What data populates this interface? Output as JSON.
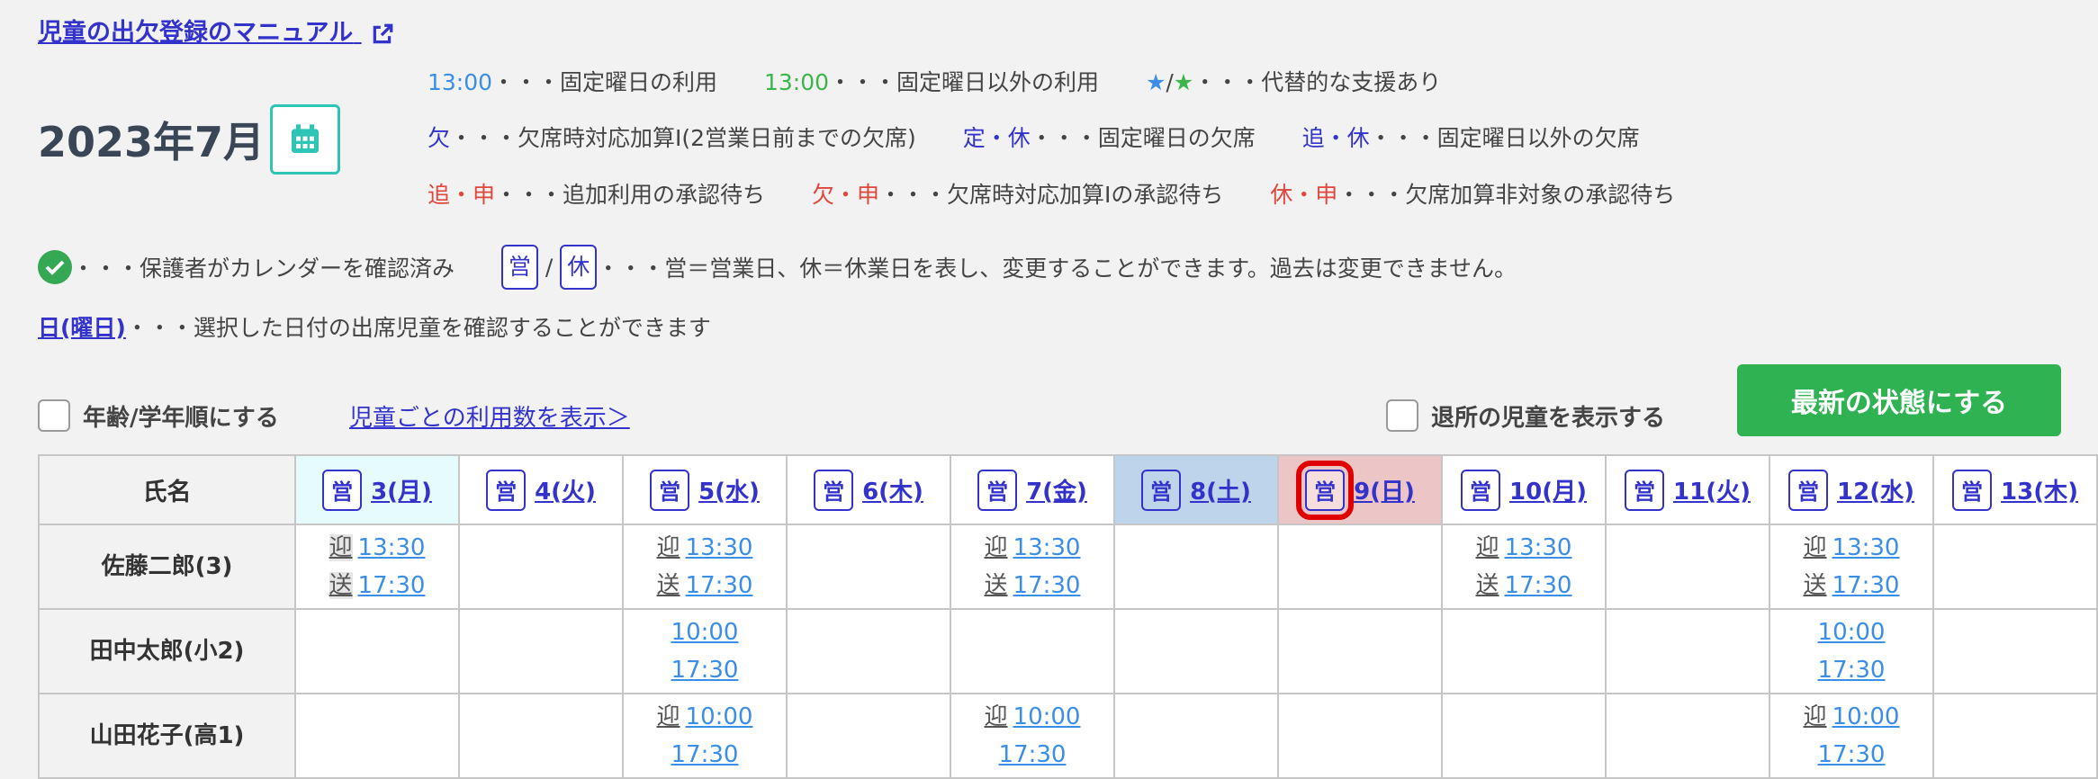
{
  "manual_link": "児童の出欠登録のマニュアル",
  "month_title": "2023年7月",
  "legend": {
    "row1": [
      {
        "sample": "13:00",
        "color": "#3a8ee6",
        "desc": "・・・固定曜日の利用"
      },
      {
        "sample": "13:00",
        "color": "#3cb54a",
        "desc": "・・・固定曜日以外の利用"
      },
      {
        "sample_a": "★",
        "sep": "/",
        "sample_b": "★",
        "desc": "・・・代替的な支援あり"
      }
    ],
    "row2": [
      {
        "sample": "欠",
        "desc": "・・・欠席時対応加算I(2営業日前までの欠席)"
      },
      {
        "sample": "定・休",
        "desc": "・・・固定曜日の欠席"
      },
      {
        "sample": "追・休",
        "desc": "・・・固定曜日以外の欠席"
      }
    ],
    "row3": [
      {
        "sample": "追・申",
        "desc": "・・・追加利用の承認待ち"
      },
      {
        "sample": "欠・申",
        "desc": "・・・欠席時対応加算Iの承認待ち"
      },
      {
        "sample": "休・申",
        "desc": "・・・欠席加算非対象の承認待ち"
      }
    ]
  },
  "confirmed_desc": "・・・保護者がカレンダーを確認済み",
  "eigyo_label": "営",
  "kyu_label": "休",
  "slash": "/",
  "eigyo_desc": "・・・営＝営業日、休＝休業日を表し、変更することができます。過去は変更できません。",
  "day_link_label": "日(曜日)",
  "day_link_desc": "・・・選択した日付の出席児童を確認することができます",
  "age_sort_label": "年齢/学年順にする",
  "usage_link": "児童ごとの利用数を表示＞",
  "show_left_label": "退所の児童を表示する",
  "refresh_button": "最新の状態にする",
  "table": {
    "name_header": "氏名",
    "days": [
      {
        "label": "3(月)",
        "eigyo": "営"
      },
      {
        "label": "4(火)",
        "eigyo": "営"
      },
      {
        "label": "5(水)",
        "eigyo": "営"
      },
      {
        "label": "6(木)",
        "eigyo": "営"
      },
      {
        "label": "7(金)",
        "eigyo": "営"
      },
      {
        "label": "8(土)",
        "eigyo": "営"
      },
      {
        "label": "9(日)",
        "eigyo": "営"
      },
      {
        "label": "10(月)",
        "eigyo": "営"
      },
      {
        "label": "11(火)",
        "eigyo": "営"
      },
      {
        "label": "12(水)",
        "eigyo": "営"
      },
      {
        "label": "13(木)",
        "eigyo": "営"
      }
    ],
    "rows": [
      {
        "name": "佐藤二郎(3)",
        "cells": [
          {
            "tag1": "迎",
            "t1": "13:30",
            "tag2": "送",
            "t2": "17:30"
          },
          {},
          {
            "tag1": "迎",
            "t1": "13:30",
            "tag2": "送",
            "t2": "17:30"
          },
          {},
          {
            "tag1": "迎",
            "t1": "13:30",
            "tag2": "送",
            "t2": "17:30"
          },
          {},
          {},
          {
            "tag1": "迎",
            "t1": "13:30",
            "tag2": "送",
            "t2": "17:30"
          },
          {},
          {
            "tag1": "迎",
            "t1": "13:30",
            "tag2": "送",
            "t2": "17:30"
          },
          {}
        ]
      },
      {
        "name": "田中太郎(小2)",
        "cells": [
          {},
          {},
          {
            "t1": "10:00",
            "t2": "17:30"
          },
          {},
          {},
          {},
          {},
          {},
          {},
          {
            "t1": "10:00",
            "t2": "17:30"
          },
          {}
        ]
      },
      {
        "name": "山田花子(高1)",
        "cells": [
          {},
          {},
          {
            "tag1": "迎",
            "t1": "10:00",
            "t2": "17:30"
          },
          {},
          {
            "tag1": "迎",
            "t1": "10:00",
            "t2": "17:30"
          },
          {},
          {},
          {},
          {},
          {
            "tag1": "迎",
            "t1": "10:00",
            "t2": "17:30"
          },
          {}
        ]
      }
    ]
  }
}
